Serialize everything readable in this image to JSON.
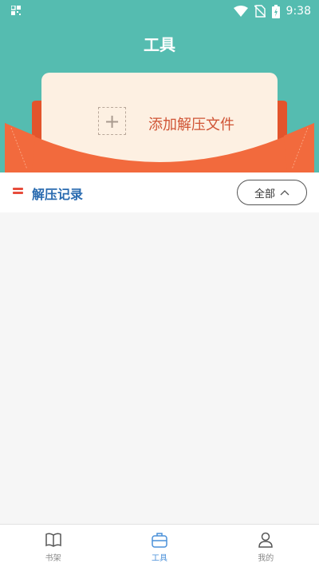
{
  "status_bar": {
    "time": "9:38",
    "icons": [
      "qr-icon",
      "wifi-icon",
      "no-sim-icon",
      "battery-charging-icon"
    ]
  },
  "header": {
    "title": "工具",
    "add_file_label": "添加解压文件",
    "add_icon": "plus-icon",
    "colors": {
      "header_bg": "#55bcb0",
      "envelope": "#f26a3d",
      "card": "#fdf0e2",
      "accent_text": "#d05435"
    }
  },
  "section": {
    "icon": "list-icon",
    "title": "解压记录",
    "filter_label": "全部",
    "filter_icon": "chevron-up-icon",
    "title_color": "#2a6bb0"
  },
  "bottom_nav": {
    "items": [
      {
        "label": "书架",
        "icon": "book-icon",
        "active": false
      },
      {
        "label": "工具",
        "icon": "toolbox-icon",
        "active": true
      },
      {
        "label": "我的",
        "icon": "user-icon",
        "active": false
      }
    ],
    "active_color": "#4a90d9"
  }
}
